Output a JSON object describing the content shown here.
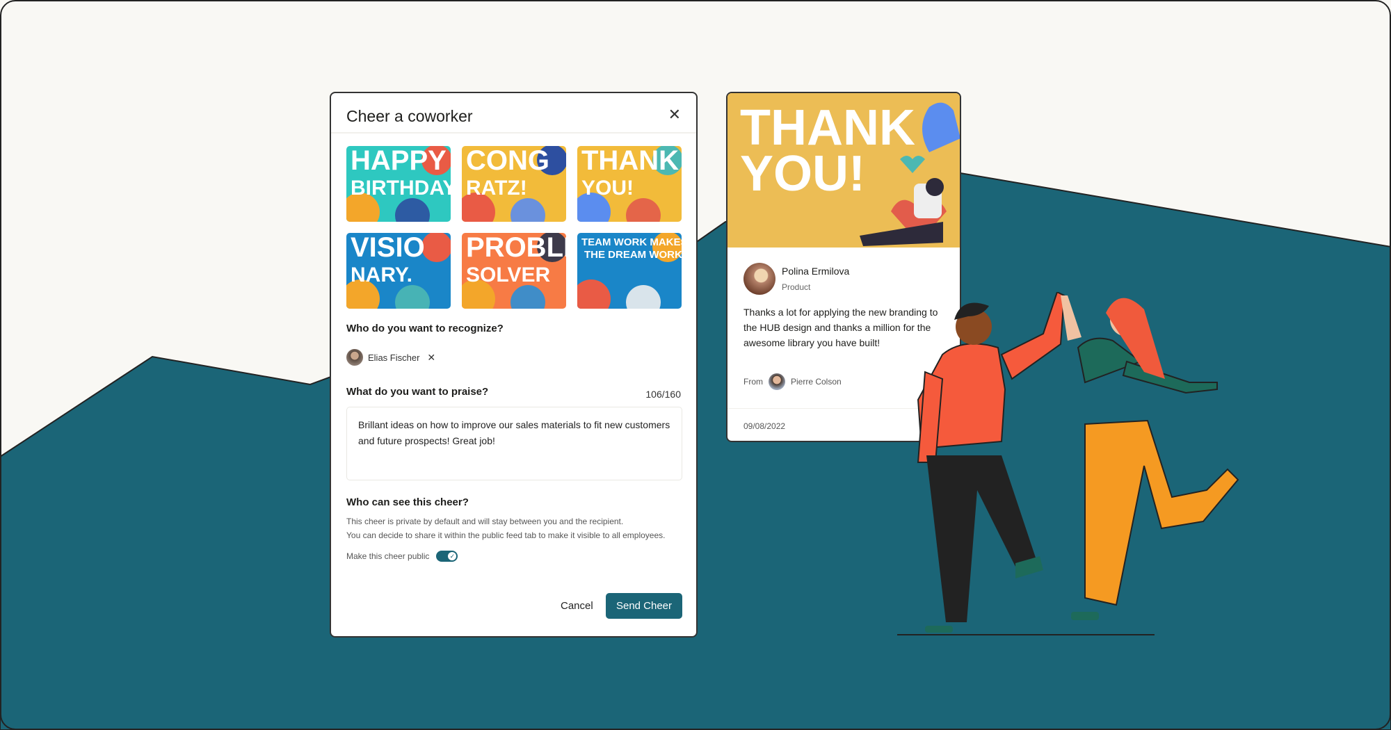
{
  "colors": {
    "background": "#f9f8f4",
    "teal": "#1b6577",
    "accent": "#1b6577",
    "card_yellow": "#ecbd55"
  },
  "modal": {
    "title": "Cheer a coworker",
    "close_icon": "close-icon",
    "templates": [
      {
        "line1": "HAPPY",
        "line2": "BIRTHDAY!",
        "bg": "#2ec8c0"
      },
      {
        "line1": "CONG",
        "line2": "RATZ!",
        "bg": "#f2bb3a"
      },
      {
        "line1": "THANK",
        "line2": "YOU!",
        "bg": "#f2bb3a"
      },
      {
        "line1": "VISIO",
        "line2": "NARY.",
        "bg": "#1a86c8"
      },
      {
        "line1": "PROBLEM",
        "line2": "SOLVER",
        "bg": "#f77b45"
      },
      {
        "line1": "TEAM WORK MAKES",
        "line2": "THE DREAM WORK",
        "bg": "#1a86c8"
      }
    ],
    "recognize_label": "Who do you want to recognize?",
    "recipient": "Elias Fischer",
    "praise_label": "What do you want to praise?",
    "char_count": "106/160",
    "praise_text": "Brillant ideas on how to improve our sales materials to fit new customers and future prospects! Great job!",
    "visibility_label": "Who can see this cheer?",
    "visibility_desc1": "This cheer is private by default and will stay between you and the recipient.",
    "visibility_desc2": "You can decide to share it within the public feed tab to make it visible to all employees.",
    "public_toggle_label": "Make this cheer public",
    "public_toggle_on": true,
    "cancel_label": "Cancel",
    "send_label": "Send Cheer"
  },
  "preview_card": {
    "image_line1": "THANK",
    "image_line2": "YOU!",
    "name": "Polina Ermilova",
    "role": "Product",
    "message": "Thanks a lot for applying the new branding to the HUB design and thanks a million for the awesome library you have built!",
    "from_label": "From",
    "from_name": "Pierre Colson",
    "date": "09/08/2022"
  }
}
